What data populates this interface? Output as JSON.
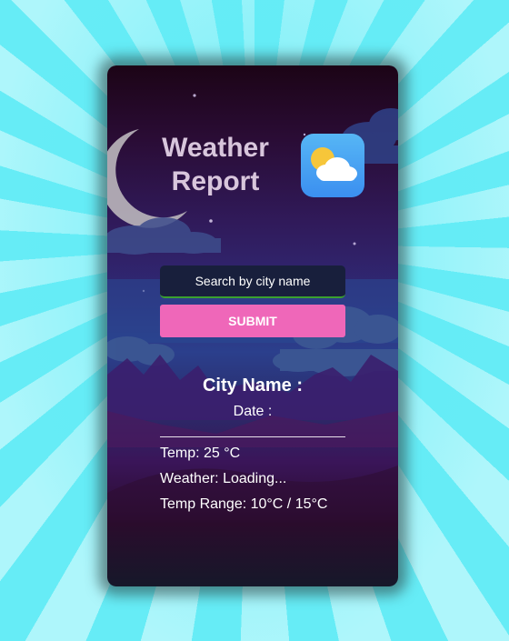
{
  "header": {
    "title_line1": "Weather",
    "title_line2": "Report",
    "app_icon": "partly-cloudy-icon"
  },
  "search": {
    "placeholder": "Search by city name",
    "value": ""
  },
  "submit_label": "SUBMIT",
  "result": {
    "city_label": "City Name :",
    "date_label": "Date :",
    "temp": "Temp: 25 °C",
    "weather": "Weather: Loading...",
    "temp_range": "Temp Range: 10°C / 15°C"
  },
  "colors": {
    "background": "#5fe9f5",
    "submit": "#ef67b9",
    "search_bg": "#181f3c",
    "search_underline": "#3aa02f"
  }
}
